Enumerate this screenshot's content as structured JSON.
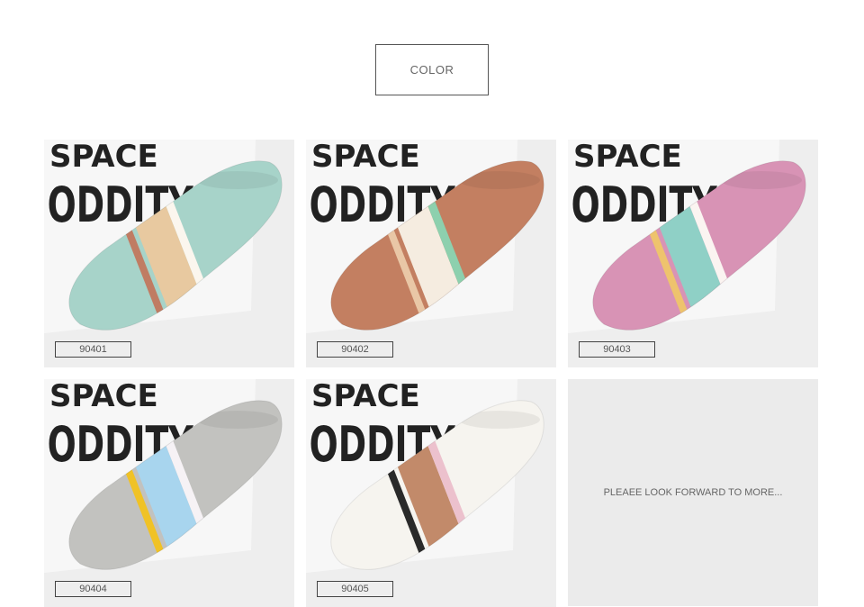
{
  "header": {
    "color_label": "COLOR"
  },
  "poster_text": {
    "line1": "SPACE",
    "line2": "ODDITY"
  },
  "products": [
    {
      "code": "90401",
      "base": "#a7d3c9",
      "stripe_a": "#e8c9a0",
      "stripe_b": "#fbf6ee",
      "stripe_c": "#c07c63"
    },
    {
      "code": "90402",
      "base": "#c37f61",
      "stripe_a": "#f5ece0",
      "stripe_b": "#8dd0ae",
      "stripe_c": "#e9c7a6"
    },
    {
      "code": "90403",
      "base": "#d893b5",
      "stripe_a": "#8fd0c6",
      "stripe_b": "#fbf4f1",
      "stripe_c": "#eec36d"
    },
    {
      "code": "90404",
      "base": "#c2c2bf",
      "stripe_a": "#a8d5ee",
      "stripe_b": "#f6f2f5",
      "stripe_c": "#f0c226"
    },
    {
      "code": "90405",
      "base": "#f6f4ef",
      "stripe_a": "#c28a6a",
      "stripe_b": "#ecc1cd",
      "stripe_c": "#2a2a2a"
    }
  ],
  "promo": {
    "text": "PLEAEE LOOK FORWARD TO MORE..."
  }
}
